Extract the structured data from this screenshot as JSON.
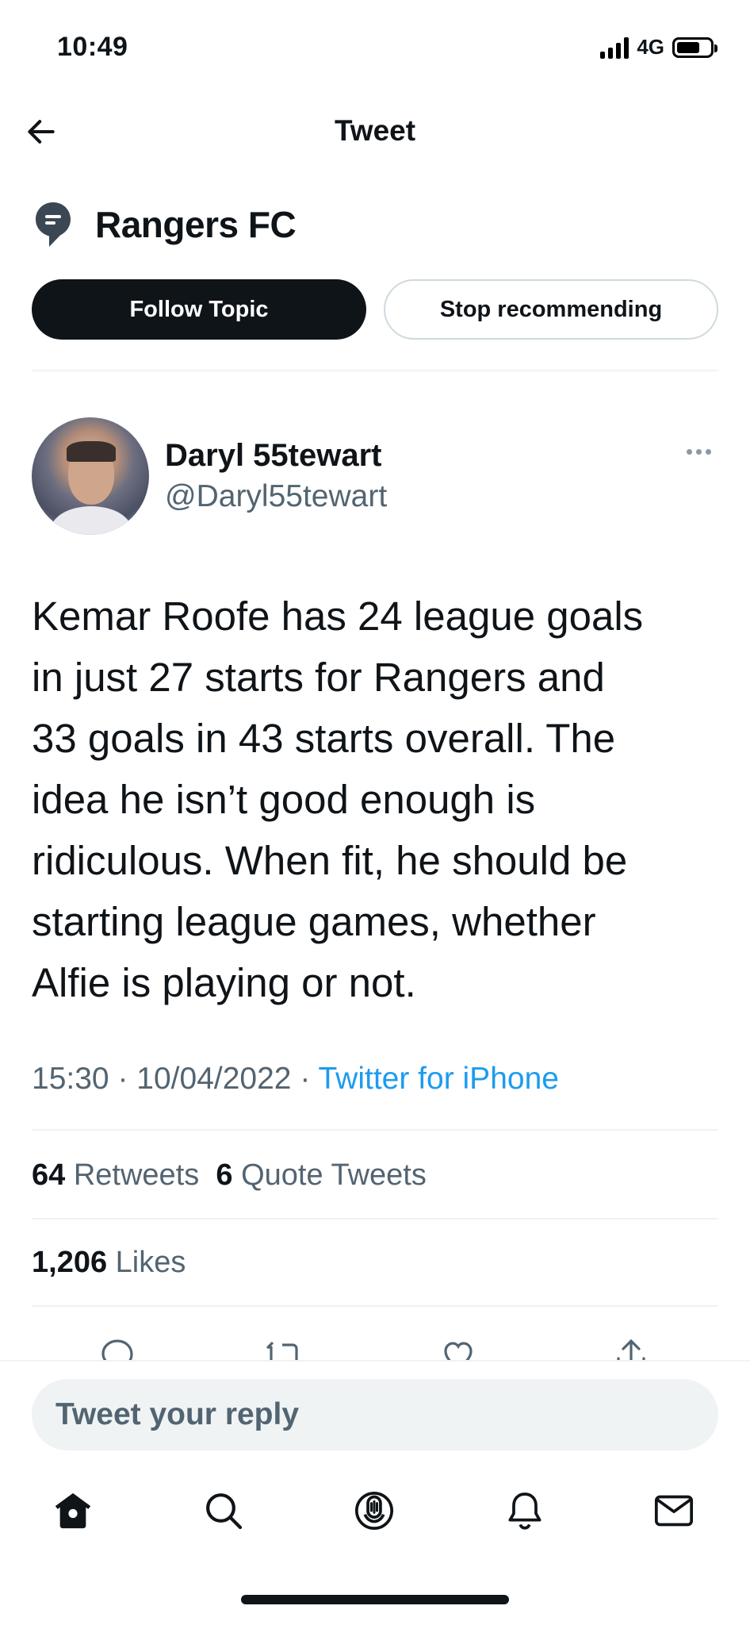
{
  "status_bar": {
    "time": "10:49",
    "network": "4G",
    "battery_level": 0.7
  },
  "header": {
    "title": "Tweet"
  },
  "topic": {
    "name": "Rangers FC",
    "follow_label": "Follow Topic",
    "stop_label": "Stop recommending"
  },
  "tweet": {
    "author_name": "Daryl 55tewart",
    "author_handle": "@Daryl55tewart",
    "text_lines": [
      "Kemar Roofe has 24 league goals",
      "in just 27 starts for Rangers and",
      "33 goals in 43 starts overall. The",
      "idea he isn’t good enough is",
      "ridiculous. When fit, he should be",
      "starting league games, whether",
      "Alfie is playing or not."
    ],
    "time": "15:30",
    "date": "10/04/2022",
    "separator": "·",
    "source": "Twitter for iPhone"
  },
  "stats": {
    "retweets_count": "64",
    "retweets_label": "Retweets",
    "quotes_count": "6",
    "quotes_label": "Quote Tweets",
    "likes_count": "1,206",
    "likes_label": "Likes"
  },
  "reply": {
    "placeholder": "Tweet your reply"
  },
  "icons": {
    "back": "arrow-left-icon",
    "topic": "topic-icon",
    "more": "more-icon",
    "reply": "reply-icon",
    "retweet": "retweet-icon",
    "like": "heart-icon",
    "share": "share-icon",
    "home": "home-icon",
    "search": "search-icon",
    "spaces": "spaces-icon",
    "notifications": "bell-icon",
    "messages": "mail-icon"
  },
  "colors": {
    "text": "#0f1419",
    "secondary": "#536471",
    "accent": "#1d9bf0",
    "divider": "#eff3f4"
  }
}
